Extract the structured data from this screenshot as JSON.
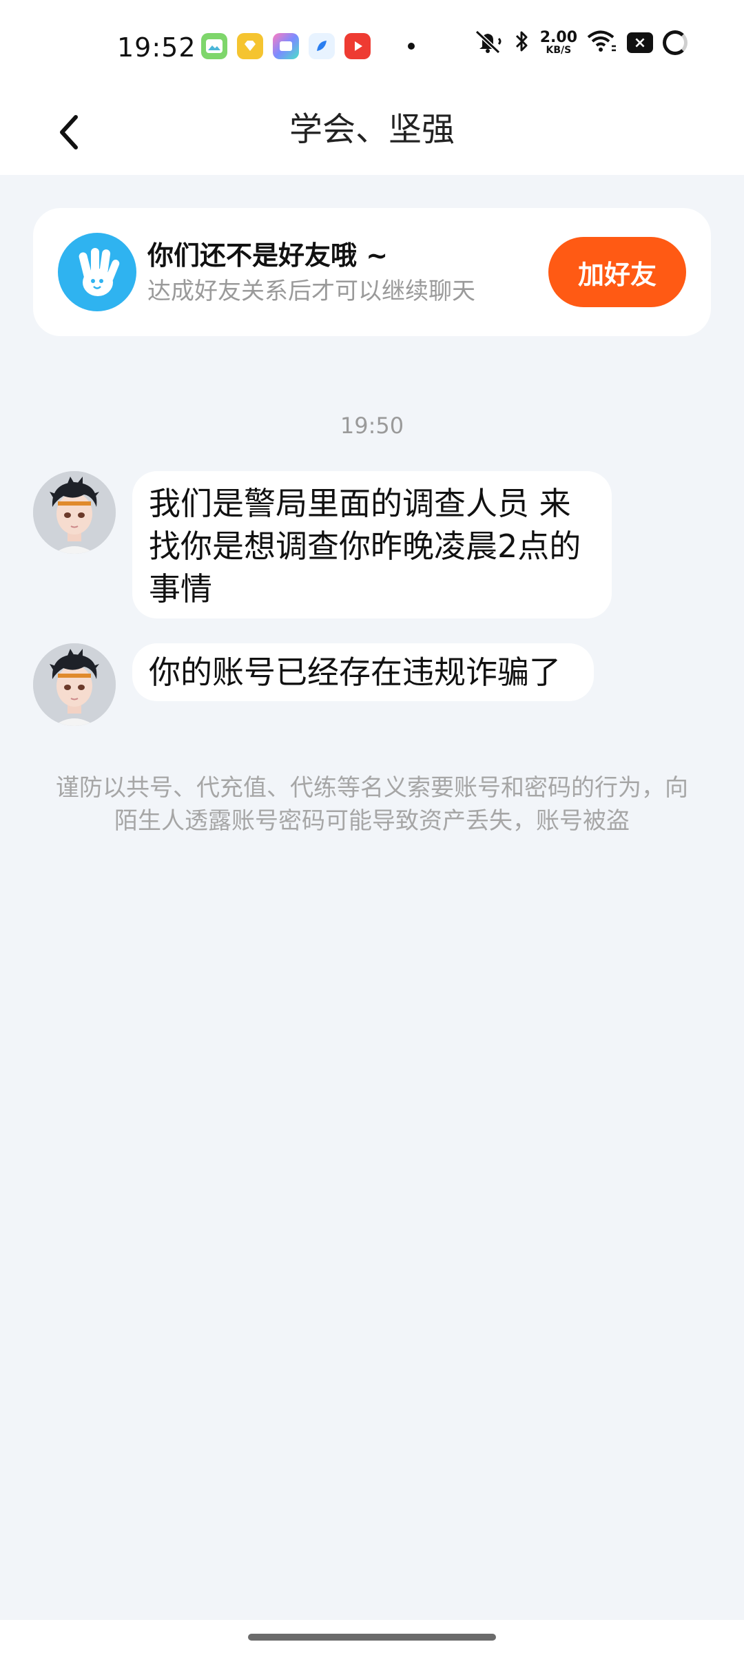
{
  "status_bar": {
    "time": "19:52",
    "net_speed_value": "2.00",
    "net_speed_unit": "KB/S",
    "battery_glyph": "×",
    "icons": [
      "gallery-icon",
      "yellow-app-icon",
      "colorful-app-icon",
      "blue-app-icon",
      "video-app-icon",
      "mute-icon",
      "bluetooth-icon",
      "wifi-icon",
      "battery-icon",
      "loading-icon"
    ]
  },
  "header": {
    "title": "学会、坚强"
  },
  "banner": {
    "title": "你们还不是好友哦 ~",
    "subtitle": "达成好友关系后才可以继续聊天",
    "button_label": "加好友",
    "button_color": "#ff5a14",
    "icon": "waving-hand-icon"
  },
  "chat": {
    "timestamp": "19:50",
    "messages": [
      {
        "text": "我们是警局里面的调查人员  来找你是想调查你昨晚凌晨2点的事情"
      },
      {
        "text": "你的账号已经存在违规诈骗了"
      }
    ],
    "warning": "谨防以共号、代充值、代练等名义索要账号和密码的行为，向陌生人透露账号密码可能导致资产丢失，账号被盗"
  }
}
